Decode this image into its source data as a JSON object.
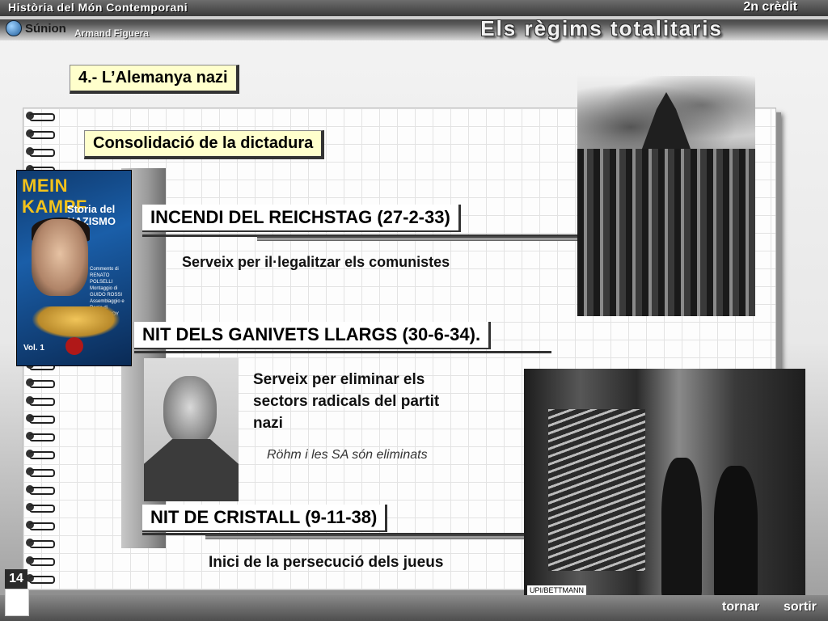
{
  "header": {
    "course": "Història del Món Contemporani",
    "credit": "2n crèdit",
    "logo_text": "Súnion",
    "author": "Armand Figuera",
    "unit_title": "Els règims totalitaris"
  },
  "section": {
    "title": "4.- L’Alemanya nazi",
    "subtitle": "Consolidació de la dictadura"
  },
  "events": [
    {
      "title": "INCENDI DEL REICHSTAG (27-2-33)",
      "desc": "Serveix per il·legalitzar els comunistes"
    },
    {
      "title": "NIT DELS GANIVETS LLARGS (30-6-34).",
      "desc_lines": [
        "Serveix per eliminar els",
        "sectors radicals del partit",
        "nazi"
      ],
      "note": "Röhm i les SA són eliminats"
    },
    {
      "title": "NIT DE CRISTALL (9-11-38)",
      "desc": "Inici de la persecució dels jueus"
    }
  ],
  "book": {
    "title": "MEIN KAMPF",
    "subtitle_lines": [
      "Storia del",
      "NAZISMO"
    ],
    "credits_lines": [
      "Commento di",
      "RENATO POLSELLI",
      "Montaggio di",
      "GUIDO ROSSI",
      "Assemblaggio e",
      "Regia di",
      "OSCAR ROY"
    ],
    "volume": "Vol. 1"
  },
  "photo_credit": "UPI/BETTMANN",
  "footer": {
    "page_number": "14",
    "back": "tornar",
    "exit": "sortir"
  }
}
